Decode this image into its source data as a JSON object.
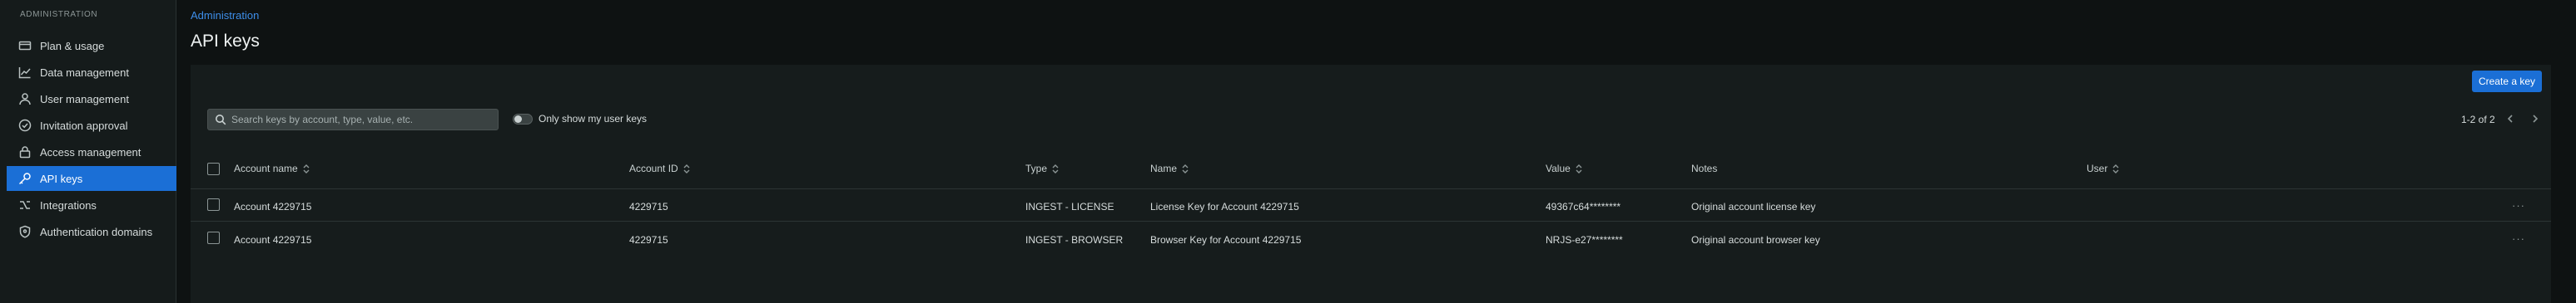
{
  "sidebar": {
    "heading": "ADMINISTRATION",
    "items": [
      {
        "label": "Plan & usage",
        "icon": "credit-card-icon"
      },
      {
        "label": "Data management",
        "icon": "chart-line-icon"
      },
      {
        "label": "User management",
        "icon": "user-icon"
      },
      {
        "label": "Invitation approval",
        "icon": "check-circle-icon"
      },
      {
        "label": "Access management",
        "icon": "lock-icon"
      },
      {
        "label": "API keys",
        "icon": "key-icon",
        "active": true
      },
      {
        "label": "Integrations",
        "icon": "integrations-icon"
      },
      {
        "label": "Authentication domains",
        "icon": "shield-icon"
      }
    ]
  },
  "header": {
    "breadcrumb": "Administration",
    "title": "API keys"
  },
  "toolbar": {
    "create_label": "Create a key",
    "search_placeholder": "Search keys by account, type, value, etc.",
    "toggle_label": "Only show my user keys",
    "pagination": "1-2 of 2"
  },
  "table": {
    "columns": [
      "Account name",
      "Account ID",
      "Type",
      "Name",
      "Value",
      "Notes",
      "User"
    ],
    "rows": [
      {
        "account_name": "Account 4229715",
        "account_id": "4229715",
        "type": "INGEST - LICENSE",
        "name": "License Key for Account 4229715",
        "value": "49367c64********",
        "notes": "Original account license key",
        "user": ""
      },
      {
        "account_name": "Account 4229715",
        "account_id": "4229715",
        "type": "INGEST - BROWSER",
        "name": "Browser Key for Account 4229715",
        "value": "NRJS-e27********",
        "notes": "Original account browser key",
        "user": ""
      }
    ]
  },
  "colors": {
    "accent": "#1b6fd6",
    "link": "#3d8eea",
    "background": "#0e1212",
    "panel": "#161c1c"
  }
}
